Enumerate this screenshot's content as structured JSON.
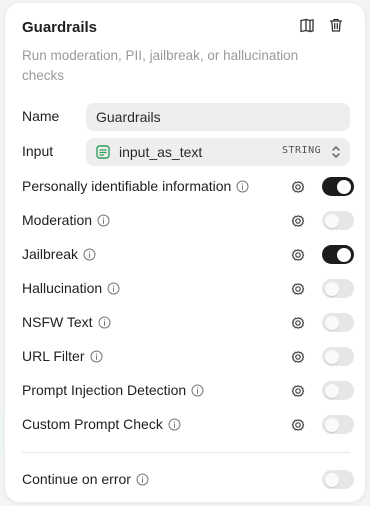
{
  "node": {
    "title": "Guardrails",
    "description": "Run moderation, PII, jailbreak, or hallucination checks"
  },
  "fields": {
    "name_label": "Name",
    "name_value": "Guardrails",
    "input_label": "Input",
    "input_value": "input_as_text",
    "input_type": "STRING"
  },
  "checks": [
    {
      "label": "Personally identifiable information",
      "enabled": true
    },
    {
      "label": "Moderation",
      "enabled": false
    },
    {
      "label": "Jailbreak",
      "enabled": true
    },
    {
      "label": "Hallucination",
      "enabled": false
    },
    {
      "label": "NSFW Text",
      "enabled": false
    },
    {
      "label": "URL Filter",
      "enabled": false
    },
    {
      "label": "Prompt Injection Detection",
      "enabled": false
    },
    {
      "label": "Custom Prompt Check",
      "enabled": false
    }
  ],
  "continue_on_error": {
    "label": "Continue on error",
    "enabled": false
  },
  "colors": {
    "toggle_on": "#1c1c1c",
    "toggle_off": "#e6e6e6",
    "variable_icon": "#2f9e5b"
  }
}
